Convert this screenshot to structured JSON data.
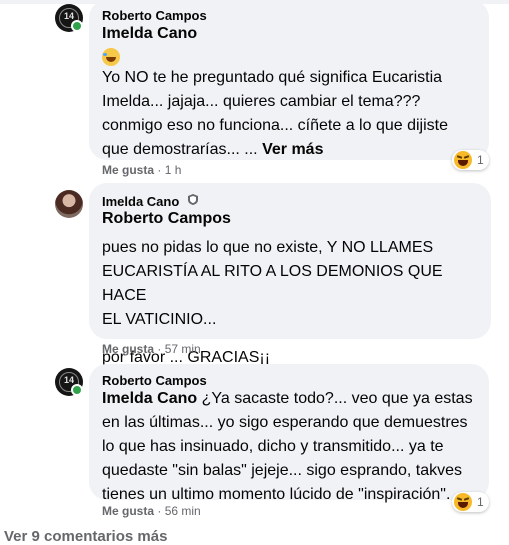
{
  "comments": [
    {
      "author": "Roberto Campos",
      "mention": "Imelda Cano",
      "text_lines": [
        "Yo NO te he preguntado qué significa Eucaristia",
        "Imelda... jajaja... quieres cambiar el tema???",
        "conmigo eso no funciona... cíñete a lo que dijiste",
        "que demostrarías... ..."
      ],
      "see_more": "Ver más",
      "like_label": "Me gusta",
      "time": "· 1 h",
      "reaction_count": "1"
    },
    {
      "author": "Imelda Cano",
      "mention": "Roberto Campos",
      "text_lines": [
        "pues no pidas lo que no existe, Y NO LLAMES",
        "EUCARISTÍA AL RITO A LOS DEMONIOS QUE HACE",
        "EL VATICINIO..."
      ],
      "text_line2": "por favor ... GRACIAS¡¡",
      "like_label": "Me gusta",
      "time": "· 57 min"
    },
    {
      "author": "Roberto Campos",
      "mention": "Imelda Cano",
      "first_line_rest": " ¿Ya sacaste todo?... veo que ya estas",
      "text_lines": [
        "en las últimas... yo sigo esperando que demuestres",
        "lo que has insinuado, dicho y transmitido... ya te",
        "quedaste \"sin balas\" jejeje... sigo esprando, takves",
        "tienes un ultimo momento lúcido de \"inspiración\"."
      ],
      "like_label": "Me gusta",
      "time": "· 56 min",
      "reaction_count": "1"
    }
  ],
  "view_more_comments": "Ver 9 comentarios más",
  "avatar_text": "14"
}
